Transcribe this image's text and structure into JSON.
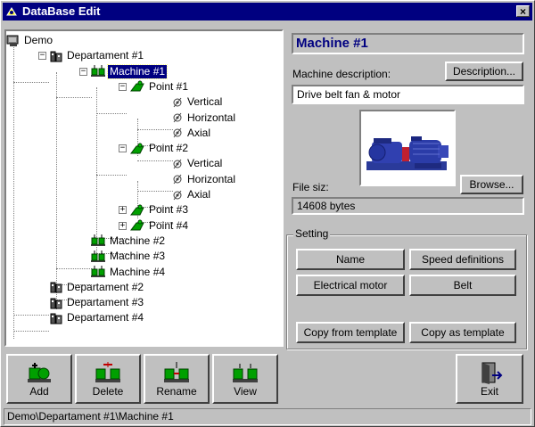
{
  "window": {
    "title": "DataBase Edit",
    "close_glyph": "×"
  },
  "tree": {
    "items": [
      {
        "label": "Demo",
        "level": 0,
        "kind": "root",
        "expander": ""
      },
      {
        "label": "Departament #1",
        "level": 1,
        "kind": "dept",
        "expander": "−"
      },
      {
        "label": "Machine #1",
        "level": 2,
        "kind": "machine",
        "expander": "−",
        "selected": true
      },
      {
        "label": "Point #1",
        "level": 3,
        "kind": "point",
        "expander": "−"
      },
      {
        "label": "Vertical",
        "level": 4,
        "kind": "axis",
        "expander": ""
      },
      {
        "label": "Horizontal",
        "level": 4,
        "kind": "axis",
        "expander": ""
      },
      {
        "label": "Axial",
        "level": 4,
        "kind": "axis",
        "expander": ""
      },
      {
        "label": "Point #2",
        "level": 3,
        "kind": "point",
        "expander": "−"
      },
      {
        "label": "Vertical",
        "level": 4,
        "kind": "axis",
        "expander": ""
      },
      {
        "label": "Horizontal",
        "level": 4,
        "kind": "axis",
        "expander": ""
      },
      {
        "label": "Axial",
        "level": 4,
        "kind": "axis",
        "expander": ""
      },
      {
        "label": "Point #3",
        "level": 3,
        "kind": "point",
        "expander": "+"
      },
      {
        "label": "Point #4",
        "level": 3,
        "kind": "point",
        "expander": "+"
      },
      {
        "label": "Machine #2",
        "level": 2,
        "kind": "machine",
        "expander": ""
      },
      {
        "label": "Machine #3",
        "level": 2,
        "kind": "machine",
        "expander": ""
      },
      {
        "label": "Machine #4",
        "level": 2,
        "kind": "machine",
        "expander": ""
      },
      {
        "label": "Departament #2",
        "level": 1,
        "kind": "dept",
        "expander": ""
      },
      {
        "label": "Departament #3",
        "level": 1,
        "kind": "dept",
        "expander": ""
      },
      {
        "label": "Departament #4",
        "level": 1,
        "kind": "dept",
        "expander": ""
      }
    ]
  },
  "details": {
    "machine_name": "Machine #1",
    "description_label": "Machine description:",
    "description_button": "Description...",
    "description_value": "Drive belt fan & motor",
    "file_size_label": "File siz:",
    "browse_button": "Browse...",
    "file_size_value": "14608 bytes"
  },
  "setting": {
    "title": "Setting",
    "buttons": {
      "name": "Name",
      "speed_definitions": "Speed definitions",
      "electrical_motor": "Electrical motor",
      "belt": "Belt",
      "copy_from_template": "Copy from template",
      "copy_as_template": "Copy as template"
    }
  },
  "toolbar": {
    "add": "Add",
    "delete": "Delete",
    "rename": "Rename",
    "view": "View",
    "exit": "Exit"
  },
  "status": {
    "path": "Demo\\Departament #1\\Machine #1"
  },
  "colors": {
    "title_bar": "#000080",
    "face": "#c0c0c0",
    "selection": "#000080",
    "icon_green": "#00a000"
  }
}
